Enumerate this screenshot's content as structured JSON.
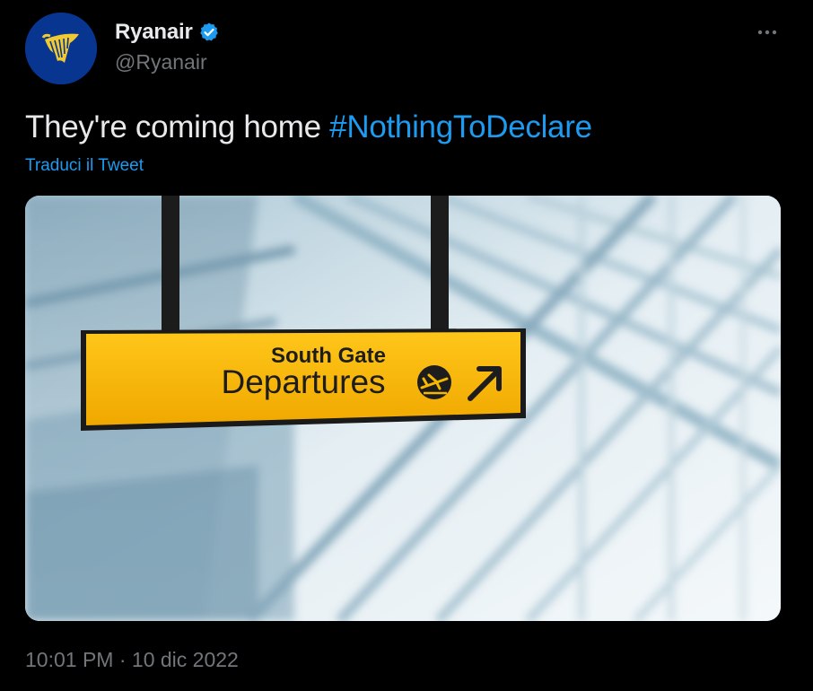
{
  "account": {
    "display_name": "Ryanair",
    "handle": "@Ryanair",
    "verified": true,
    "avatar_icon": "ryanair-harp-logo-icon"
  },
  "tweet": {
    "text": "They're coming home ",
    "hashtag": "#NothingToDeclare",
    "translate_label": "Traduci il Tweet",
    "time": "10:01 PM",
    "separator": " · ",
    "date": "10 dic 2022"
  },
  "media": {
    "sign_line_1": "South Gate",
    "sign_line_2": "Departures"
  },
  "colors": {
    "background": "#000000",
    "text": "#e7e9ea",
    "secondary": "#71767b",
    "link": "#1d9bf0",
    "sign_yellow": "#f5b800"
  }
}
